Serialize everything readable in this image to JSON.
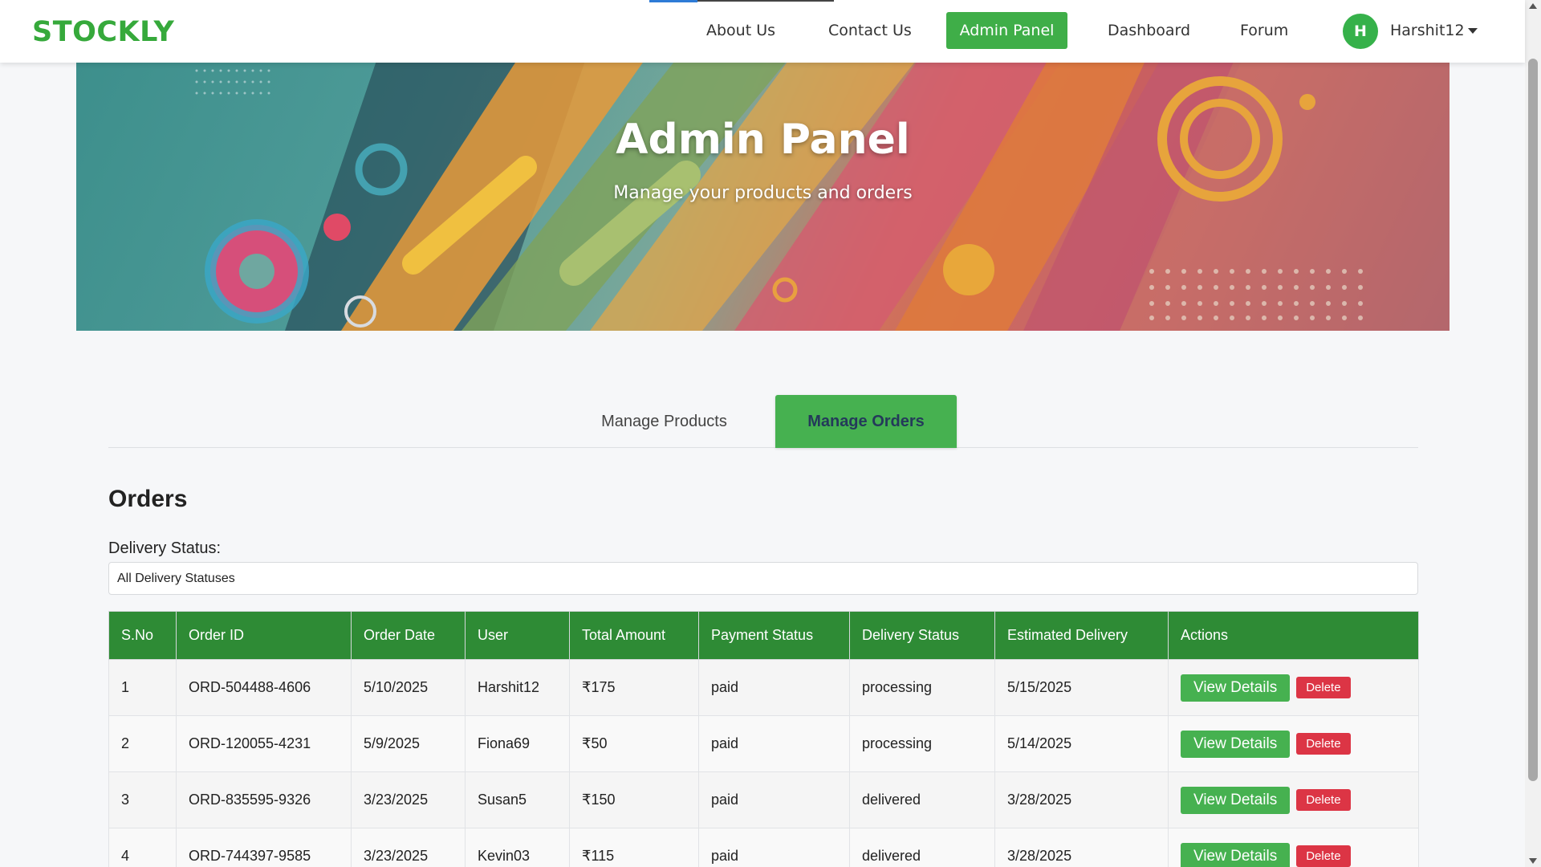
{
  "brand": "STOCKLY",
  "nav": {
    "about": "About Us",
    "contact": "Contact Us",
    "admin": "Admin Panel",
    "dashboard": "Dashboard",
    "forum": "Forum",
    "avatar_initial": "H",
    "username": "Harshit12"
  },
  "hero": {
    "title": "Admin Panel",
    "subtitle": "Manage your products and orders"
  },
  "tabs": {
    "products": "Manage Products",
    "orders": "Manage Orders"
  },
  "orders": {
    "title": "Orders",
    "filter_label": "Delivery Status:",
    "filter_value": "All Delivery Statuses",
    "columns": [
      "S.No",
      "Order ID",
      "Order Date",
      "User",
      "Total Amount",
      "Payment Status",
      "Delivery Status",
      "Estimated Delivery",
      "Actions"
    ],
    "view_label": "View Details",
    "delete_label": "Delete",
    "rows": [
      {
        "sno": "1",
        "id": "ORD-504488-4606",
        "date": "5/10/2025",
        "user": "Harshit12",
        "amount": "₹175",
        "payment": "paid",
        "delivery": "processing",
        "eta": "5/15/2025"
      },
      {
        "sno": "2",
        "id": "ORD-120055-4231",
        "date": "5/9/2025",
        "user": "Fiona69",
        "amount": "₹50",
        "payment": "paid",
        "delivery": "processing",
        "eta": "5/14/2025"
      },
      {
        "sno": "3",
        "id": "ORD-835595-9326",
        "date": "3/23/2025",
        "user": "Susan5",
        "amount": "₹150",
        "payment": "paid",
        "delivery": "delivered",
        "eta": "3/28/2025"
      },
      {
        "sno": "4",
        "id": "ORD-744397-9585",
        "date": "3/23/2025",
        "user": "Kevin03",
        "amount": "₹115",
        "payment": "paid",
        "delivery": "delivered",
        "eta": "3/28/2025"
      }
    ]
  },
  "colors": {
    "brand": "#36a93b",
    "primary_button": "#46b150",
    "table_header": "#2e8b35",
    "delete_button": "#dc3545"
  }
}
